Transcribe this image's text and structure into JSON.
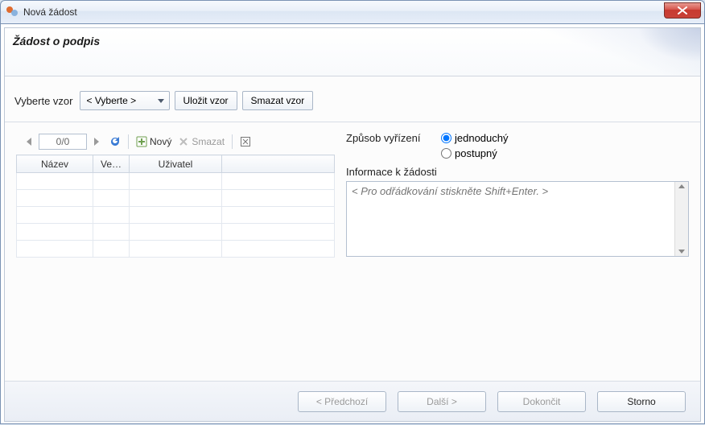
{
  "window": {
    "title": "Nová žádost"
  },
  "header": {
    "title": "Žádost o podpis"
  },
  "template": {
    "label": "Vyberte vzor",
    "select_placeholder": "< Vyberte >",
    "save_btn": "Uložit vzor",
    "delete_btn": "Smazat vzor"
  },
  "pager": {
    "value": "0/0",
    "new_btn": "Nový",
    "delete_btn": "Smazat"
  },
  "grid": {
    "columns": {
      "name": "Název",
      "version": "Ve…",
      "user": "Uživatel",
      "extra": ""
    }
  },
  "form": {
    "mode_label": "Způsob vyřízení",
    "mode_simple": "jednoduchý",
    "mode_step": "postupný",
    "mode_selected": "simple",
    "info_label": "Informace k žádosti",
    "info_placeholder": "< Pro odřádkování stiskněte Shift+Enter. >"
  },
  "footer": {
    "prev": "< Předchozí",
    "next": "Další >",
    "finish": "Dokončit",
    "cancel": "Storno"
  }
}
